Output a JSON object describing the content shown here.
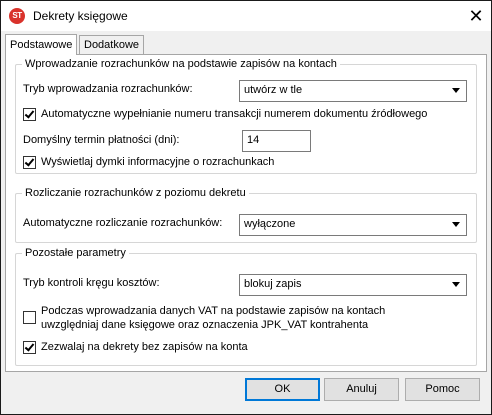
{
  "window": {
    "title": "Dekrety księgowe",
    "close_glyph": "✕",
    "icon_text": "ST"
  },
  "tabs": [
    {
      "label": "Podstawowe",
      "active": true
    },
    {
      "label": "Dodatkowe",
      "active": false
    }
  ],
  "group1": {
    "title": "Wprowadzanie rozrachunków na podstawie zapisów na kontach",
    "mode_label": "Tryb wprowadzania rozrachunków:",
    "mode_value": "utwórz w tle",
    "auto_fill_label": "Automatyczne wypełnianie numeru transakcji numerem dokumentu źródłowego",
    "auto_fill_checked": true,
    "due_label": "Domyślny termin płatności (dni):",
    "due_value": "14",
    "tooltips_label": "Wyświetlaj dymki informacyjne o rozrachunkach",
    "tooltips_checked": true
  },
  "group2": {
    "title": "Rozliczanie rozrachunków z poziomu dekretu",
    "auto_settle_label": "Automatyczne rozliczanie rozrachunków:",
    "auto_settle_value": "wyłączone"
  },
  "group3": {
    "title": "Pozostałe parametry",
    "cost_label": "Tryb kontroli kręgu kosztów:",
    "cost_value": "blokuj zapis",
    "vat_line1": "Podczas wprowadzania danych VAT na podstawie zapisów na kontach",
    "vat_line2": "uwzględniaj dane księgowe oraz oznaczenia JPK_VAT kontrahenta",
    "vat_checked": false,
    "allow_label": "Zezwalaj na dekrety bez zapisów na konta",
    "allow_checked": true
  },
  "buttons": {
    "ok": "OK",
    "cancel": "Anuluj",
    "help": "Pomoc"
  }
}
